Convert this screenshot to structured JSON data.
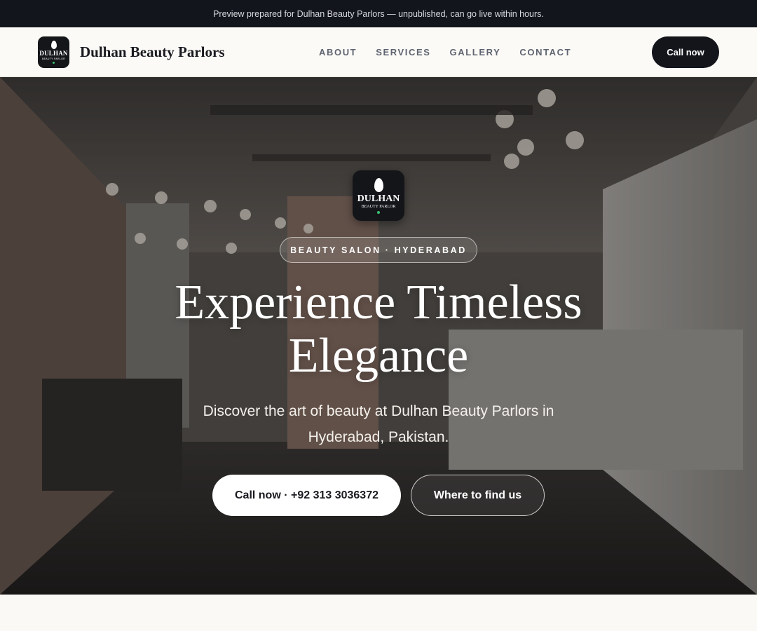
{
  "preview_banner": "Preview prepared for Dulhan Beauty Parlors — unpublished, can go live within hours.",
  "header": {
    "brand_name": "Dulhan Beauty Parlors",
    "logo_text": "DULHAN",
    "logo_subtext": "BEAUTY PARLOR",
    "nav": [
      "ABOUT",
      "SERVICES",
      "GALLERY",
      "CONTACT"
    ],
    "cta_label": "Call now"
  },
  "hero": {
    "logo_text": "DULHAN",
    "logo_subtext": "BEAUTY PARLOR",
    "eyebrow": "BEAUTY SALON · HYDERABAD",
    "headline": "Experience Timeless Elegance",
    "subhead": "Discover the art of beauty at Dulhan Beauty Parlors in Hyderabad, Pakistan.",
    "primary_cta": "Call now · +92 313 3036372",
    "secondary_cta": "Where to find us"
  },
  "colors": {
    "dark": "#13151b",
    "accent_dot": "#38c172",
    "page_bg": "#faf9f6"
  }
}
